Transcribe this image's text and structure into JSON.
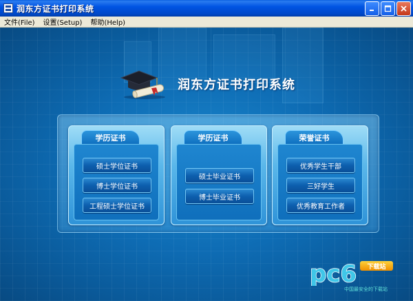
{
  "window": {
    "title": "润东方证书打印系统",
    "app_icon": "app-icon",
    "buttons": [
      "minimize-icon",
      "maximize-icon",
      "close-icon"
    ]
  },
  "menu": {
    "items": [
      {
        "label": "文件(File)"
      },
      {
        "label": "设置(Setup)"
      },
      {
        "label": "帮助(Help)"
      }
    ]
  },
  "main": {
    "heading": "润东方证书打印系统",
    "logo": "graduation-cap-diploma-icon",
    "panels": [
      {
        "title": "学历证书",
        "buttons": [
          "硕士学位证书",
          "博士学位证书",
          "工程硕士学位证书"
        ]
      },
      {
        "title": "学历证书",
        "buttons": [
          "硕士毕业证书",
          "博士毕业证书"
        ]
      },
      {
        "title": "荣誉证书",
        "buttons": [
          "优秀学生干部",
          "三好学生",
          "优秀教育工作者"
        ]
      }
    ]
  },
  "watermark": {
    "logo_text": "pc6",
    "badge": "下载站",
    "caption": "中国最安全的下载站"
  },
  "colors": {
    "titlebar": "#0054e3",
    "background": "#0a5a9a",
    "panel": "#5ab7ea",
    "button": "#0d5fae"
  }
}
